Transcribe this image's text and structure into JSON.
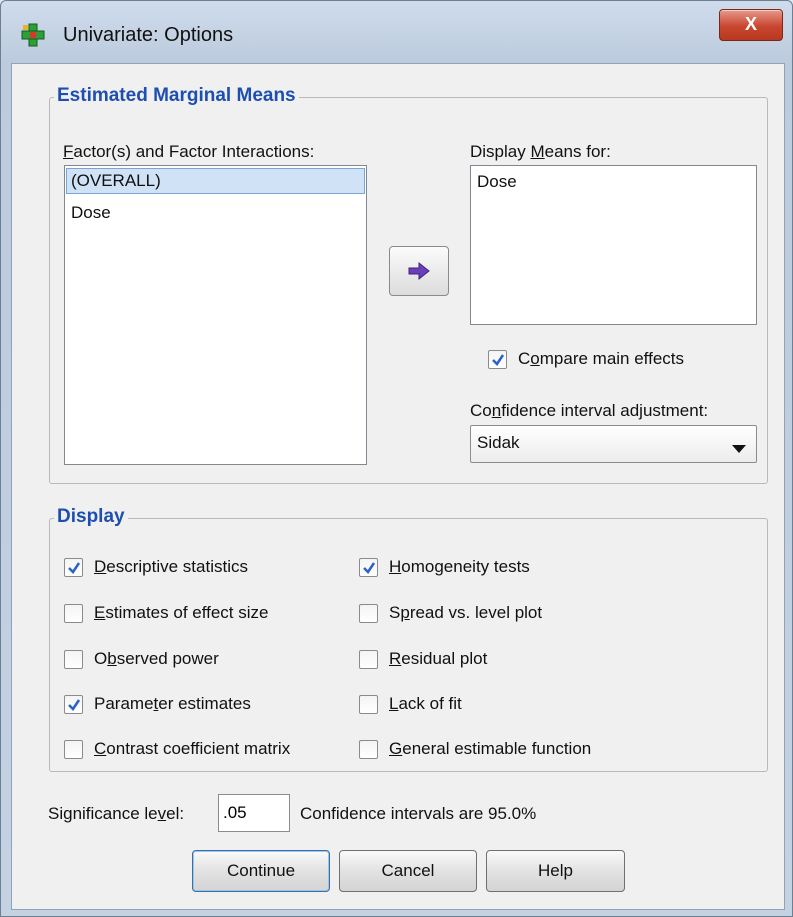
{
  "window": {
    "title": "Univariate: Options",
    "close_label": "X"
  },
  "emm": {
    "legend": "Estimated Marginal Means",
    "factors_label_pre": "",
    "factors_label_u": "F",
    "factors_label_post": "actor(s) and Factor Interactions:",
    "factors": [
      {
        "label": "(OVERALL)",
        "selected": true
      },
      {
        "label": "Dose",
        "selected": false
      }
    ],
    "display_means_pre": "Display ",
    "display_means_u": "M",
    "display_means_post": "eans for:",
    "display_means_items": [
      "Dose"
    ],
    "compare_main_effects": {
      "pre": "C",
      "u": "o",
      "post": "mpare main effects",
      "checked": true
    },
    "ci_adjust_pre": "Co",
    "ci_adjust_u": "n",
    "ci_adjust_post": "fidence interval adjustment:",
    "ci_adjust_value": "Sidak"
  },
  "display": {
    "legend": "Display",
    "options_left": [
      {
        "pre": "",
        "u": "D",
        "post": "escriptive statistics",
        "checked": true
      },
      {
        "pre": "",
        "u": "E",
        "post": "stimates of effect size",
        "checked": false
      },
      {
        "pre": "O",
        "u": "b",
        "post": "served power",
        "checked": false
      },
      {
        "pre": "Parame",
        "u": "t",
        "post": "er estimates",
        "checked": true
      },
      {
        "pre": "",
        "u": "C",
        "post": "ontrast coefficient matrix",
        "checked": false
      }
    ],
    "options_right": [
      {
        "pre": "",
        "u": "H",
        "post": "omogeneity tests",
        "checked": true
      },
      {
        "pre": "S",
        "u": "p",
        "post": "read vs. level plot",
        "checked": false
      },
      {
        "pre": "",
        "u": "R",
        "post": "esidual plot",
        "checked": false
      },
      {
        "pre": "",
        "u": "L",
        "post": "ack of fit",
        "checked": false
      },
      {
        "pre": "",
        "u": "G",
        "post": "eneral estimable function",
        "checked": false
      }
    ]
  },
  "significance": {
    "label_pre": "Significance le",
    "label_u": "v",
    "label_post": "el:",
    "value": ".05",
    "ci_text": "Confidence intervals are 95.0%"
  },
  "buttons": {
    "continue": "Continue",
    "cancel": "Cancel",
    "help": "Help"
  },
  "colors": {
    "legend_text": "#1e4fb0",
    "check": "#2a62c8",
    "selection": "#cfe2f6"
  },
  "icons": {
    "app": "spss-options-icon",
    "close": "close-icon",
    "arrow": "right-arrow-icon",
    "dropdown": "chevron-down-icon"
  }
}
